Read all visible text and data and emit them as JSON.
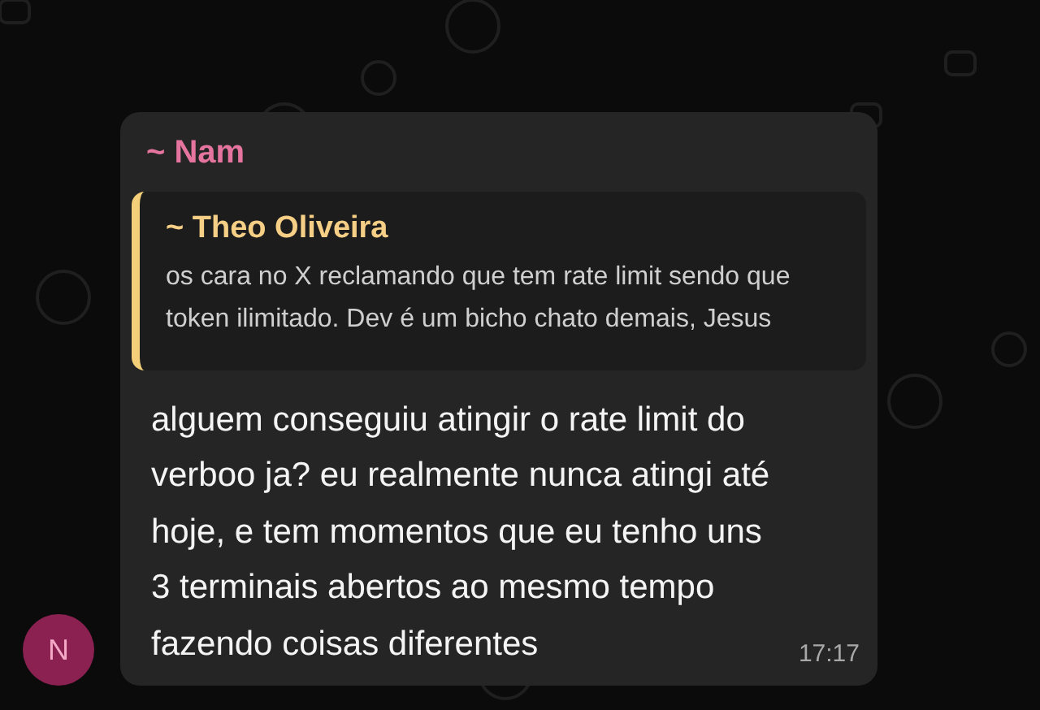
{
  "message": {
    "sender": "~ Nam",
    "quote": {
      "author": "~ Theo Oliveira",
      "text": "os cara no X reclamando que tem rate limit sendo que token ilimitado. Dev é um bicho chato demais, Jesus"
    },
    "text": "alguem conseguiu atingir o rate limit do verboo ja? eu realmente nunca atingi até hoje, e tem momentos que eu tenho uns 3 terminais abertos ao mesmo tempo fazendo coisas diferentes",
    "time": "17:17",
    "avatar": {
      "initial": "N",
      "color": "#8a2150"
    }
  }
}
